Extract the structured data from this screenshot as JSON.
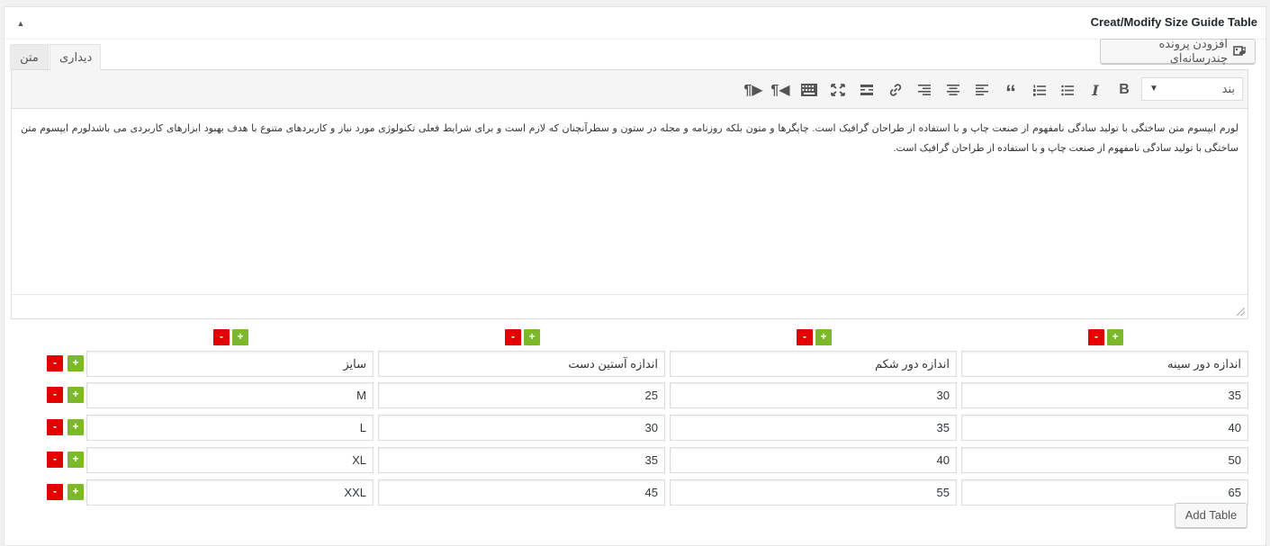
{
  "box": {
    "title": "Creat/Modify Size Guide Table",
    "toggle_icon": "triangle-up-icon"
  },
  "editor": {
    "media_button_label": "افزودن پرونده چندرسانه‌ای",
    "tabs": {
      "visual": "دیداری",
      "text": "متن"
    },
    "format_select": {
      "value": "بند"
    },
    "toolbar_icons": [
      "bold-icon",
      "italic-icon",
      "bullet-list-icon",
      "numbered-list-icon",
      "blockquote-icon",
      "align-left-icon",
      "align-center-icon",
      "align-right-icon",
      "link-icon",
      "read-more-icon",
      "fullscreen-icon",
      "toolbar-toggle-icon",
      "rtl-icon",
      "ltr-icon"
    ],
    "content": "لورم ایپسوم متن ساختگی با تولید سادگی نامفهوم از صنعت چاپ و با استفاده از طراحان گرافیک است. چاپگرها و متون بلکه روزنامه و مجله در ستون و سطرآنچنان که لازم است و برای شرایط فعلی تکنولوژی مورد نیاز و کاربردهای متنوع با هدف بهبود ابزارهای کاربردی می باشدلورم ایپسوم متن ساختگی با تولید سادگی نامفهوم از صنعت چاپ و با استفاده از طراحان گرافیک است."
  },
  "table": {
    "minus_label": "-",
    "plus_label": "+",
    "headers": [
      "اندازه دور سینه",
      "اندازه دور شکم",
      "اندازه آستین دست",
      "سایز"
    ],
    "rows": [
      [
        "35",
        "30",
        "25",
        "M"
      ],
      [
        "40",
        "35",
        "30",
        "L"
      ],
      [
        "50",
        "40",
        "35",
        "XL"
      ],
      [
        "65",
        "55",
        "45",
        "XXL"
      ]
    ],
    "add_table_label": "Add Table"
  },
  "colors": {
    "minus": "#e30000",
    "plus": "#7bb928"
  }
}
